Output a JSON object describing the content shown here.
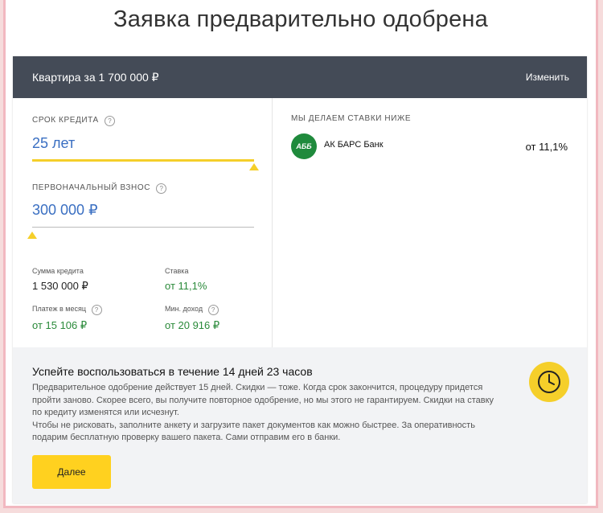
{
  "page_title": "Заявка предварительно одобрена",
  "header": {
    "title": "Квартира за 1 700 000 ₽",
    "change_label": "Изменить"
  },
  "form": {
    "term": {
      "label": "Срок кредита",
      "value": "25 лет",
      "fill_fraction": 1.0
    },
    "down_payment": {
      "label": "Первоначальный взнос",
      "value": "300 000 ₽",
      "fill_fraction": 0.0
    },
    "help_glyph": "?"
  },
  "stats": {
    "loan_amount": {
      "label": "Сумма кредита",
      "value": "1 530 000 ₽"
    },
    "rate": {
      "label": "Ставка",
      "value": "от 11,1%"
    },
    "monthly_payment": {
      "label": "Платеж в месяц",
      "value": "от 15 106 ₽"
    },
    "min_income": {
      "label": "Мин. доход",
      "value": "от 20 916 ₽"
    }
  },
  "banks": {
    "heading": "Мы делаем ставки ниже",
    "items": [
      {
        "logo_text": "АББ",
        "name": "АК БАРС Банк",
        "rate": "от 11,1%"
      }
    ]
  },
  "promo": {
    "title": "Успейте воспользоваться в течение 14 дней 23 часов",
    "paragraph1": "Предварительное одобрение действует 15 дней. Скидки — тоже. Когда срок закончится, процедуру придется пройти заново. Скорее всего, вы получите повторное одобрение, но мы этого не гарантируем. Скидки на ставку по кредиту изменятся или исчезнут.",
    "paragraph2": "Чтобы не рисковать, заполните анкету и загрузите пакет документов как можно быстрее. За оперативность подарим бесплатную проверку вашего пакета. Сами отправим его в банки.",
    "button_label": "Далее",
    "icon": "clock-icon"
  },
  "colors": {
    "header_bg": "#444b57",
    "accent_yellow": "#f5cf2a",
    "input_blue": "#3a6fc2",
    "positive_green": "#2a8a3a",
    "bank_green": "#1f8a3c"
  }
}
